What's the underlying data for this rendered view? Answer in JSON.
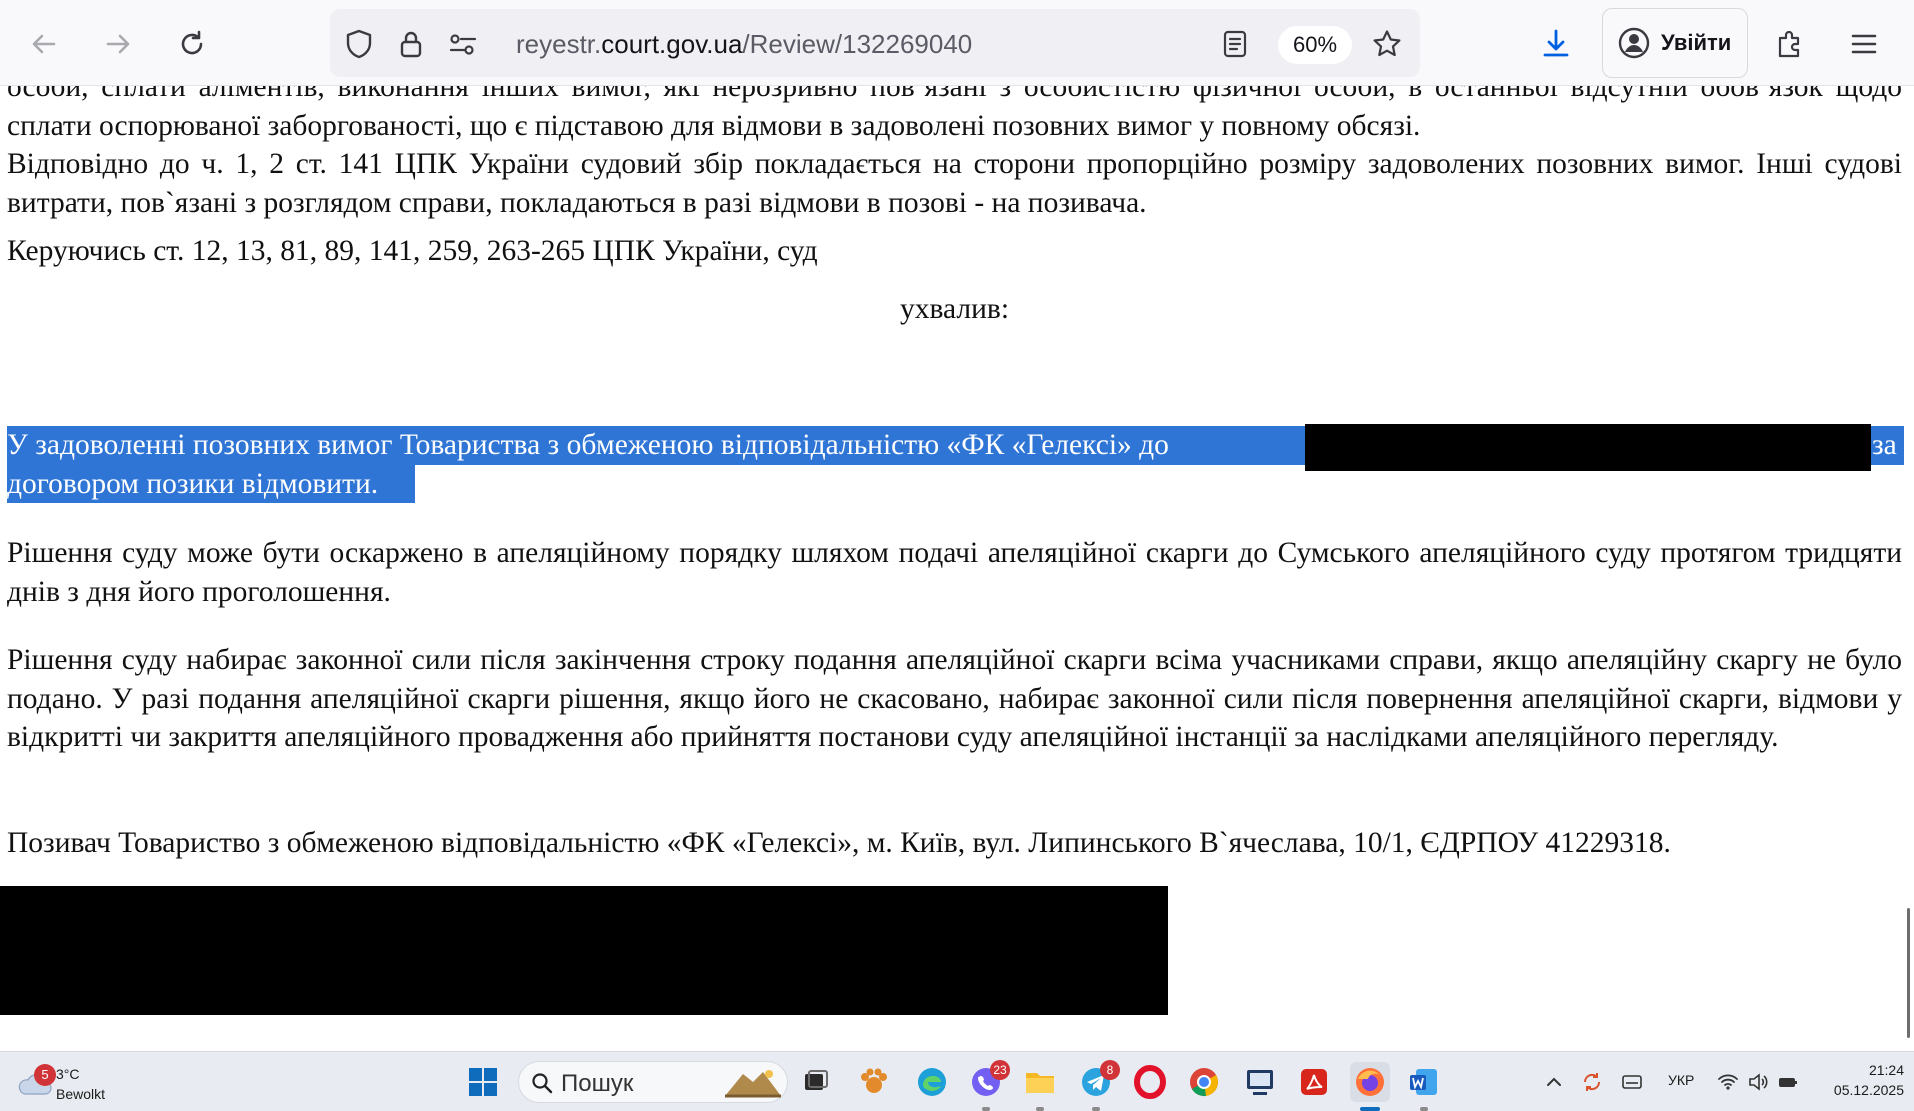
{
  "browser": {
    "url_prefix": "reyestr.",
    "url_domain": "court.gov.ua",
    "url_path": "/Review/132269040",
    "zoom": "60%",
    "signin_label": "Увійти"
  },
  "document": {
    "p0": "особи, сплати аліментів, виконання інших вимог, які нерозривно пов`язані з особистістю фізичної особи, в останньої відсутній обов`язок щодо сплати оспорюваної заборгованості, що є підставою для відмови в задоволені позовних вимог у повному обсязі.",
    "p1": "Відповідно до ч. 1, 2 ст. 141 ЦПК України судовий збір покладається на сторони пропорційно розміру задоволених позовних вимог. Інші судові витрати, пов`язані з розглядом справи, покладаються в разі відмови в позові - на позивача.",
    "p2": "Керуючись ст. 12, 13, 81, 89, 141, 259, 263-265 ЦПК України, суд",
    "p3": "ухвалив:",
    "p4_start": "У задоволенні позовних вимог Товариства з обмеженою відповідальністю «ФК «Гелексі» до",
    "p4_end": "за",
    "p4_line2": "договором позики відмовити.",
    "p5": "Рішення суду може бути оскаржено в апеляційному порядку шляхом подачі апеляційної скарги до Сумського апеляційного суду протягом тридцяти днів з дня його проголошення.",
    "p6": "Рішення суду набирає законної сили після закінчення строку подання апеляційної скарги всіма учасниками справи, якщо апеляційну скаргу не було подано. У разі подання апеляційної скарги рішення, якщо його не скасовано, набирає законної сили після повернення апеляційної скарги, відмови у відкритті чи закриття апеляційного провадження або прийняття постанови суду апеляційної інстанції за наслідками апеляційного перегляду.",
    "p7": "Позивач Товариство з обмеженою відповідальністю «ФК «Гелексі», м. Київ, вул. Липинського В`ячеслава, 10/1, ЄДРПОУ 41229318."
  },
  "taskbar": {
    "weather_badge": "5",
    "weather_temp": "3°C",
    "weather_desc": "Bewolkt",
    "search_placeholder": "Пошук",
    "viber_badge": "23",
    "telegram_badge": "8",
    "language": "УКР",
    "time": "21:24",
    "date": "05.12.2025"
  },
  "colors": {
    "selection": "#2f75d6",
    "accent": "#0f6cbd"
  }
}
